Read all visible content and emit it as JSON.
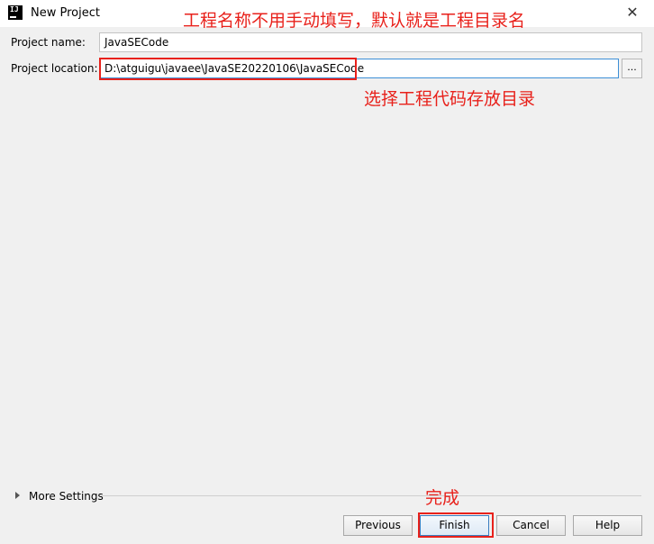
{
  "window": {
    "title": "New Project",
    "app_icon_text": "IJ",
    "close_glyph": "✕"
  },
  "form": {
    "project_name_label": "Project name:",
    "project_name_value": "JavaSECode",
    "project_location_label": "Project location:",
    "project_location_value": "D:\\atguigu\\javaee\\JavaSE20220106\\JavaSECode",
    "browse_label": "..."
  },
  "annotations": {
    "name_note": "工程名称不用手动填写，默认就是工程目录名",
    "location_note": "选择工程代码存放目录",
    "finish_note": "完成"
  },
  "more_settings": {
    "label": "More Settings"
  },
  "buttons": {
    "previous": "Previous",
    "finish": "Finish",
    "cancel": "Cancel",
    "help": "Help"
  },
  "colors": {
    "annotation": "#e8211b",
    "focus_border": "#3d8fd6",
    "background": "#f0f0f0"
  },
  "icons": {
    "app": "intellij-idea-icon",
    "close": "close-icon",
    "expand": "triangle-right-icon"
  }
}
